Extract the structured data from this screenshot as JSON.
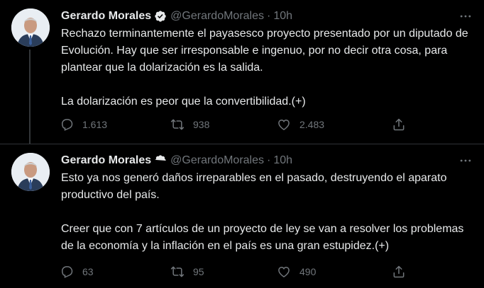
{
  "tweets": [
    {
      "author_name": "Gerardo Morales",
      "handle": "@GerardoMorales",
      "separator": "·",
      "time": "10h",
      "paragraphs": [
        "Rechazo terminantemente el payasesco proyecto presentado por un diputado de Evolución. Hay que ser irresponsable e ingenuo, por no decir otra cosa, para plantear que la dolarización es la salida.",
        "La dolarización es peor que la convertibilidad.(+)"
      ],
      "replies": "1.613",
      "retweets": "938",
      "likes": "2.483"
    },
    {
      "author_name": "Gerardo Morales",
      "handle": "@GerardoMorales",
      "separator": "·",
      "time": "10h",
      "paragraphs": [
        "Esto ya nos generó daños irreparables en el pasado, destruyendo el aparato productivo del país.",
        "Creer que con 7 artículos de un proyecto de ley se van a resolver los problemas de la economía y la inflación en el país es una gran estupidez.(+)"
      ],
      "replies": "63",
      "retweets": "95",
      "likes": "490"
    }
  ],
  "icons": {
    "verified": "verified-badge-icon",
    "more": "more-horizontal-icon",
    "reply": "reply-icon",
    "retweet": "retweet-icon",
    "like": "heart-icon",
    "share": "share-icon"
  },
  "colors": {
    "background": "#000000",
    "text": "#e7e9ea",
    "secondary": "#71767b",
    "divider": "#2f3336",
    "verified": "#e7e9ea"
  }
}
